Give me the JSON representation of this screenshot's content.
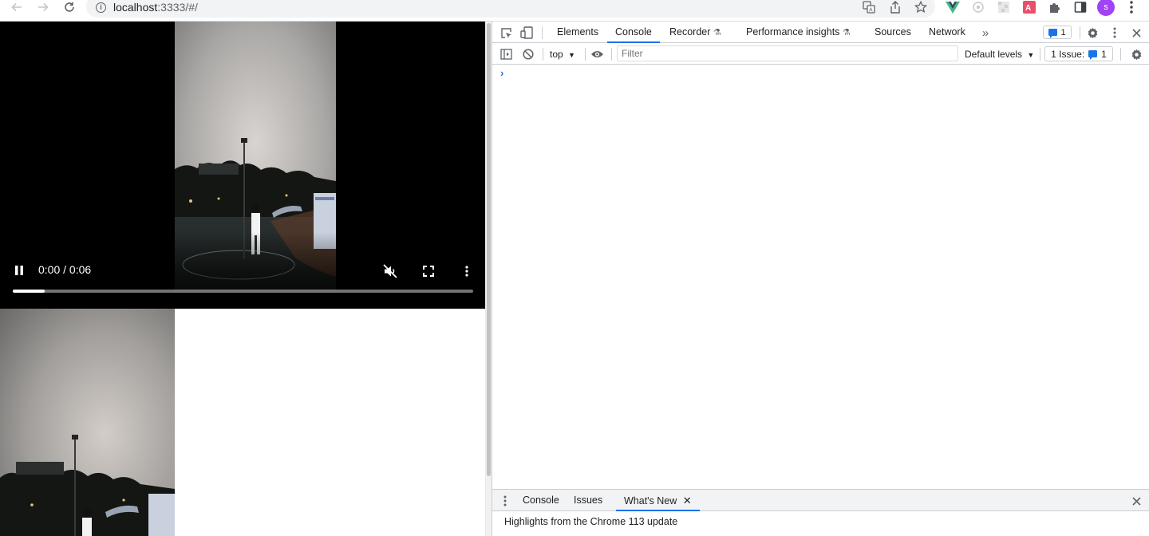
{
  "browser": {
    "url_host": "localhost",
    "url_path": ":3333/#/",
    "profile_initial": "s"
  },
  "video": {
    "time_display": "0:00 / 0:06",
    "progress_fraction": 0.07
  },
  "devtools": {
    "tabs": [
      "Elements",
      "Console",
      "Recorder",
      "Performance insights",
      "Sources",
      "Network"
    ],
    "active_tab": "Console",
    "issues_count_badge": "1",
    "context": "top",
    "filter_placeholder": "Filter",
    "levels": "Default levels",
    "issues_label": "1 Issue:",
    "issues_count": "1",
    "drawer_tabs": [
      "Console",
      "Issues",
      "What's New"
    ],
    "drawer_active": "What's New",
    "drawer_message": "Highlights from the Chrome 113 update"
  },
  "colors": {
    "accent": "#1a73e8",
    "profile": "#a142f4",
    "vue": "#42b883"
  }
}
